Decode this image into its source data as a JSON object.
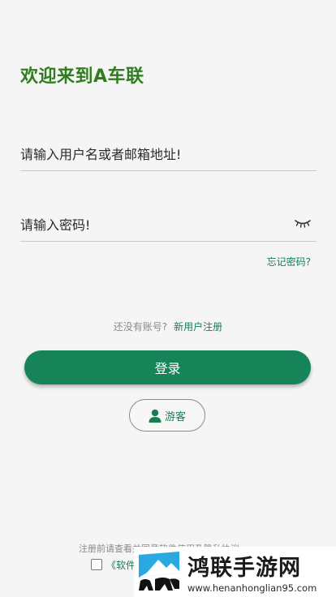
{
  "header": {
    "title": "欢迎来到A车联"
  },
  "form": {
    "username_placeholder": "请输入用户名或者邮箱地址!",
    "password_placeholder": "请输入密码!",
    "password_toggle_icon": "eye-closed-icon",
    "forgot_password": "忘记密码?"
  },
  "register": {
    "hint": "还没有账号?",
    "link": "新用户注册"
  },
  "buttons": {
    "login": "登录",
    "guest": "游客",
    "guest_icon": "person-icon"
  },
  "agreement": {
    "text": "注册前请查看并同意软件使用及隐私协议",
    "link": "《软件",
    "checked": false
  },
  "watermark": {
    "title": "鸿联手游网",
    "url": "www.henanhonglian95.com"
  },
  "colors": {
    "brand_green": "#178358",
    "title_green": "#2e7d1f",
    "link_green": "#1a7d52",
    "background": "#f5f5f5"
  }
}
